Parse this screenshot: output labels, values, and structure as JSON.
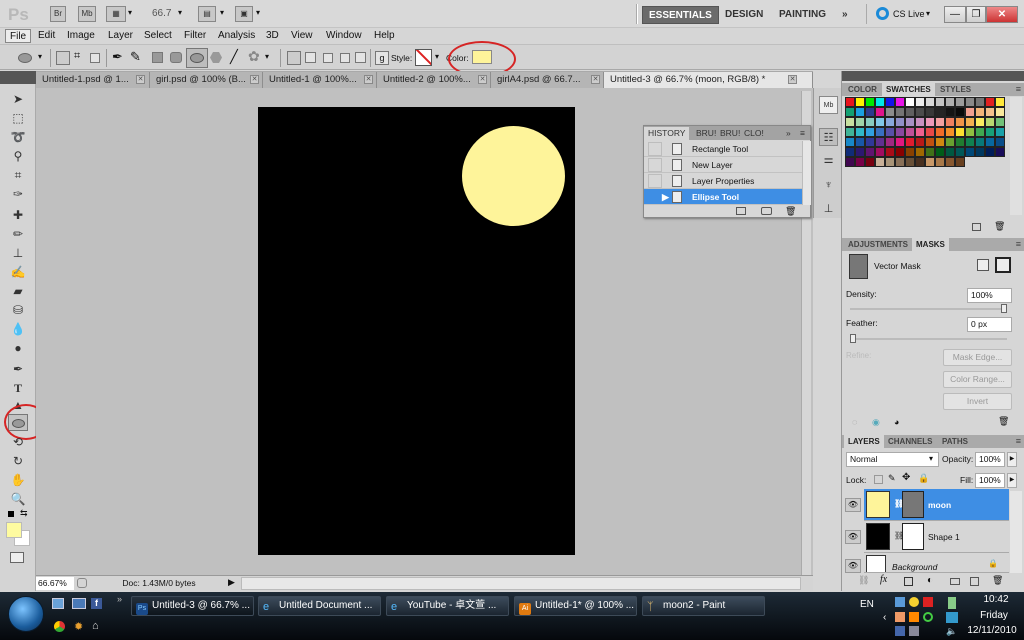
{
  "appbar": {
    "logo": "Ps",
    "bridge_btn": "Br",
    "minibridge_btn": "Mb",
    "zoom_value": "66.7",
    "workspaces": [
      "ESSENTIALS",
      "DESIGN",
      "PAINTING"
    ],
    "more_workspaces": "»",
    "cs_live": "CS Live",
    "window_buttons": {
      "minimize": "—",
      "restore": "❐",
      "close": "✕"
    }
  },
  "menu": [
    "File",
    "Edit",
    "Image",
    "Layer",
    "Select",
    "Filter",
    "Analysis",
    "3D",
    "View",
    "Window",
    "Help"
  ],
  "options": {
    "style_label": "Style:",
    "color_label": "Color:",
    "color_value": "#fef49a"
  },
  "tabs": [
    {
      "label": "Untitled-1.psd @ 1...",
      "active": false
    },
    {
      "label": "girl.psd @ 100% (B...",
      "active": false
    },
    {
      "label": "Untitled-1 @ 100%...",
      "active": false
    },
    {
      "label": "Untitled-2 @ 100%...",
      "active": false
    },
    {
      "label": "girlA4.psd @ 66.7...",
      "active": false
    },
    {
      "label": "Untitled-3 @ 66.7% (moon, RGB/8) *",
      "active": true
    }
  ],
  "tools": [
    "move",
    "marquee",
    "lasso",
    "quick-select",
    "crop",
    "eyedropper",
    "healing-brush",
    "brush",
    "clone-stamp",
    "history-brush",
    "eraser",
    "paint-bucket",
    "blur",
    "dodge",
    "pen",
    "type",
    "path-selection",
    "ellipse",
    "3d-rotate",
    "3d-orbit",
    "hand",
    "zoom"
  ],
  "colors": {
    "foreground": "#fefba0",
    "background": "#ffffff",
    "moon": "#fef49a",
    "canvas": "#000000",
    "accent": "#3e8ee4",
    "annotation": "#d62424"
  },
  "status": {
    "zoom": "66.67%",
    "doc": "Doc: 1.43M/0 bytes"
  },
  "history": {
    "tabs": [
      "HISTORY",
      "BRU!",
      "BRU!",
      "CLO!"
    ],
    "items": [
      "Rectangle Tool",
      "New Layer",
      "Layer Properties",
      "Ellipse Tool"
    ],
    "selected": 3
  },
  "swatches_panel": {
    "tabs": [
      "COLOR",
      "SWATCHES",
      "STYLES"
    ],
    "active": "SWATCHES",
    "swatches": [
      "#e8141c",
      "#fff200",
      "#00e800",
      "#00e8e8",
      "#1414e8",
      "#e814e8",
      "#ffffff",
      "#ececec",
      "#d8d8d8",
      "#c4c4c4",
      "#b0b0b0",
      "#9c9c9c",
      "#888888",
      "#747474",
      "#e02020",
      "#ffe83a",
      "#13a072",
      "#1aa0e0",
      "#2c3b8c",
      "#e0148c",
      "#8c8c8c",
      "#747474",
      "#606060",
      "#4c4c4c",
      "#383838",
      "#242424",
      "#141414",
      "#0a0a0a",
      "#f4a090",
      "#f4b478",
      "#f4c08c",
      "#f8e89c",
      "#c8e0a0",
      "#a0d4a8",
      "#88ccc0",
      "#80c8e8",
      "#88a8dc",
      "#9090c8",
      "#a890c4",
      "#c890c0",
      "#ec98b8",
      "#f4a0a0",
      "#f08060",
      "#f09448",
      "#f4b050",
      "#fcec60",
      "#b8d870",
      "#70c078",
      "#40b498",
      "#30b8c8",
      "#30a0e0",
      "#3870c0",
      "#5850a8",
      "#8848a0",
      "#c05098",
      "#f06090",
      "#e84848",
      "#f06c28",
      "#f49028",
      "#fce030",
      "#90c040",
      "#40a850",
      "#18a078",
      "#18a0a8",
      "#1888c8",
      "#1858a8",
      "#303898",
      "#603090",
      "#a02880",
      "#e01880",
      "#e01c30",
      "#b81818",
      "#c05010",
      "#d08810",
      "#68a030",
      "#207c30",
      "#108050",
      "#087878",
      "#0868a0",
      "#084c88",
      "#102c78",
      "#2c1870",
      "#601470",
      "#a00c60",
      "#a80c18",
      "#880000",
      "#884000",
      "#a06800",
      "#407018",
      "#005c18",
      "#005840",
      "#005858",
      "#004878",
      "#003860",
      "#001c58",
      "#180c58",
      "#400850",
      "#780048",
      "#780010",
      "#c8b098",
      "#a89478",
      "#887058",
      "#685038",
      "#483020",
      "#c89868",
      "#a87848",
      "#885830",
      "#684020"
    ]
  },
  "masks_panel": {
    "tabs": [
      "ADJUSTMENTS",
      "MASKS"
    ],
    "active": "MASKS",
    "mask_type": "Vector Mask",
    "density_label": "Density:",
    "density_value": "100%",
    "density_fraction": 1.0,
    "feather_label": "Feather:",
    "feather_value": "0 px",
    "feather_fraction": 0.0,
    "refine_label": "Refine:",
    "buttons": [
      "Mask Edge...",
      "Color Range...",
      "Invert"
    ]
  },
  "layers_panel": {
    "tabs": [
      "LAYERS",
      "CHANNELS",
      "PATHS"
    ],
    "active": "LAYERS",
    "blend_mode": "Normal",
    "opacity_label": "Opacity:",
    "opacity_value": "100%",
    "lock_label": "Lock:",
    "fill_label": "Fill:",
    "fill_value": "100%",
    "layers": [
      {
        "name": "moon",
        "selected": true,
        "thumb": "#fef49a"
      },
      {
        "name": "Shape 1",
        "selected": false,
        "thumb": "#000000"
      },
      {
        "name": "Background",
        "selected": false,
        "thumb": "#ffffff"
      }
    ]
  },
  "taskbar": {
    "items": [
      {
        "label": "Untitled-3 @ 66.7% ...",
        "icon": "photoshop-icon",
        "active": true
      },
      {
        "label": "Untitled Document ...",
        "icon": "ie-icon",
        "active": false
      },
      {
        "label": "YouTube - 卓文萱 ...",
        "icon": "ie-icon",
        "active": false
      },
      {
        "label": "Untitled-1* @ 100% ...",
        "icon": "illustrator-icon",
        "active": false
      },
      {
        "label": "moon2 - Paint",
        "icon": "paint-icon",
        "active": false
      }
    ],
    "language": "EN",
    "time": "10:42",
    "day": "Friday",
    "date": "12/11/2010"
  }
}
